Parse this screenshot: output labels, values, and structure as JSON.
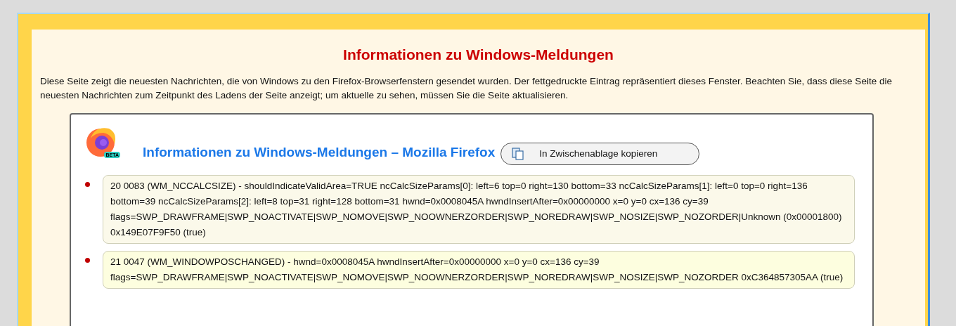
{
  "page": {
    "title": "Informationen zu Windows-Meldungen",
    "intro": "Diese Seite zeigt die neuesten Nachrichten, die von Windows zu den Firefox-Browserfenstern gesendet wurden. Der fettgedruckte Eintrag repräsentiert dieses Fenster. Beachten Sie, dass diese Seite die neuesten Nachrichten zum Zeitpunkt des Ladens der Seite anzeigt; um aktuelle zu sehen, müssen Sie die Seite aktualisieren."
  },
  "window_section": {
    "logo_badge": "BETA",
    "title": "Informationen zu Windows-Meldungen – Mozilla Firefox",
    "copy_button": "In Zwischenablage kopieren",
    "messages": [
      {
        "text": "20 0083 (WM_NCCALCSIZE) - shouldIndicateValidArea=TRUE ncCalcSizeParams[0]: left=6 top=0 right=130 bottom=33 ncCalcSizeParams[1]: left=0 top=0 right=136 bottom=39 ncCalcSizeParams[2]: left=8 top=31 right=128 bottom=31 hwnd=0x0008045A hwndInsertAfter=0x00000000 x=0 y=0 cx=136 cy=39 flags=SWP_DRAWFRAME|SWP_NOACTIVATE|SWP_NOMOVE|SWP_NOOWNERZORDER|SWP_NOREDRAW|SWP_NOSIZE|SWP_NOZORDER|Unknown (0x00001800) 0x149E07F9F50 (true)",
        "color": "#fbf9ea"
      },
      {
        "text": "21 0047 (WM_WINDOWPOSCHANGED) - hwnd=0x0008045A hwndInsertAfter=0x00000000 x=0 y=0 cx=136 cy=39 flags=SWP_DRAWFRAME|SWP_NOACTIVATE|SWP_NOMOVE|SWP_NOOWNERZORDER|SWP_NOREDRAW|SWP_NOSIZE|SWP_NOZORDER 0xC364857305AA (true)",
        "color": "#fdfedf"
      }
    ]
  }
}
